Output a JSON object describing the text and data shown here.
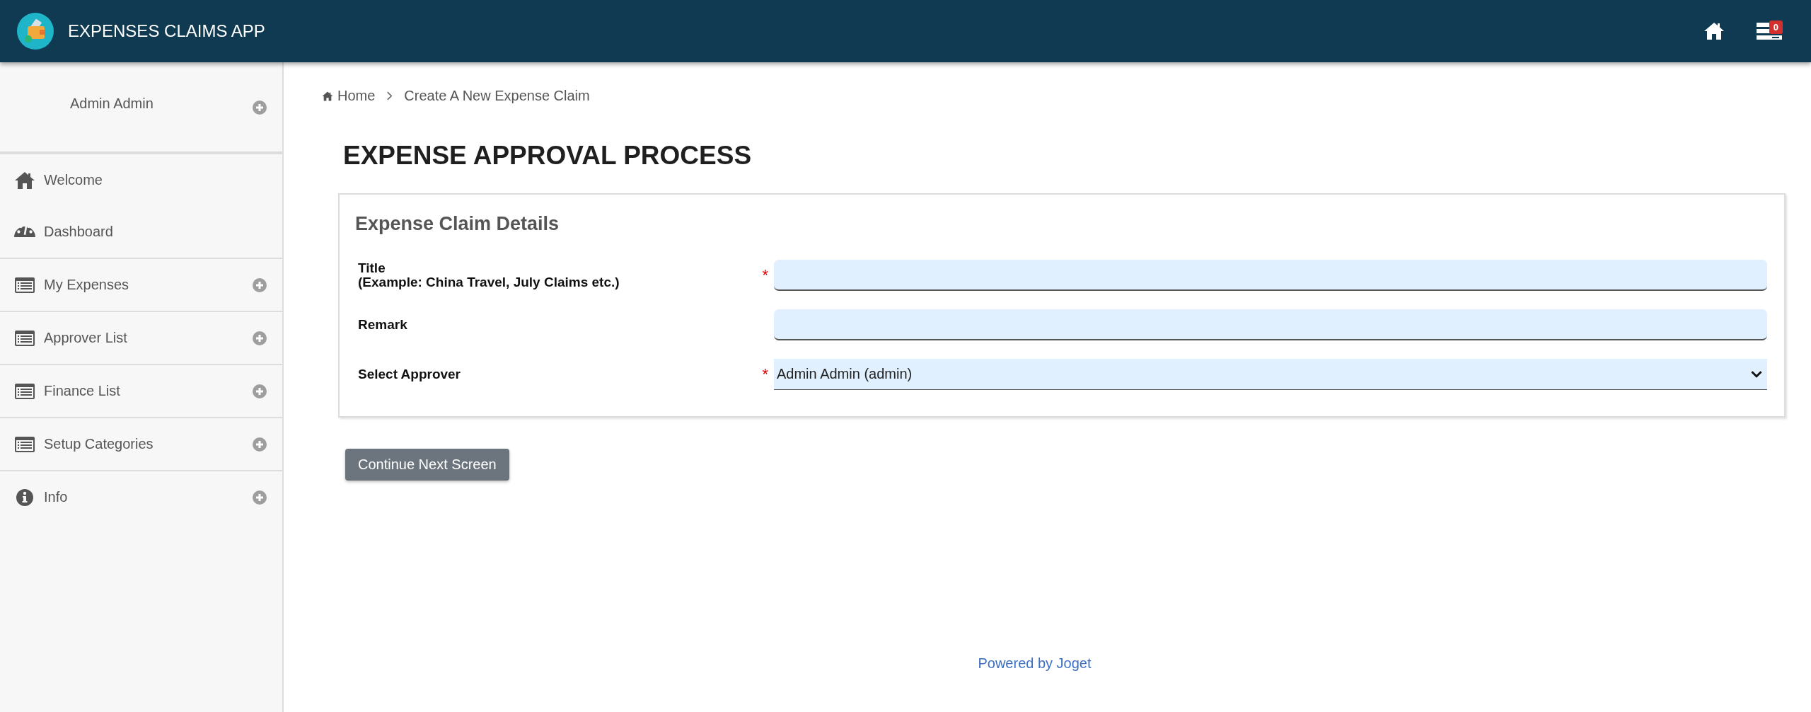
{
  "header": {
    "app_title": "EXPENSES CLAIMS APP",
    "inbox_count": "0"
  },
  "sidebar": {
    "user": "Admin Admin",
    "items": [
      {
        "label": "Welcome",
        "kind": "home",
        "expandable": false
      },
      {
        "label": "Dashboard",
        "kind": "dashboard",
        "expandable": false
      },
      {
        "label": "My Expenses",
        "kind": "list",
        "expandable": true
      },
      {
        "label": "Approver List",
        "kind": "list",
        "expandable": true
      },
      {
        "label": "Finance List",
        "kind": "list",
        "expandable": true
      },
      {
        "label": "Setup Categories",
        "kind": "list",
        "expandable": true
      },
      {
        "label": "Info",
        "kind": "info",
        "expandable": true
      }
    ]
  },
  "breadcrumb": [
    "Home",
    "Create A New Expense Claim"
  ],
  "page_title": "EXPENSE APPROVAL PROCESS",
  "form": {
    "section_title": "Expense Claim Details",
    "required_mark": "*",
    "fields": [
      {
        "label": "Title",
        "hint": "(Example: China Travel, July Claims etc.)",
        "kind": "text",
        "required": true
      },
      {
        "label": "Remark",
        "kind": "text",
        "required": false
      },
      {
        "label": "Select Approver",
        "kind": "select",
        "required": true,
        "value": "Admin Admin (admin)"
      }
    ]
  },
  "continue_button": "Continue Next Screen",
  "footer": "Powered by Joget"
}
